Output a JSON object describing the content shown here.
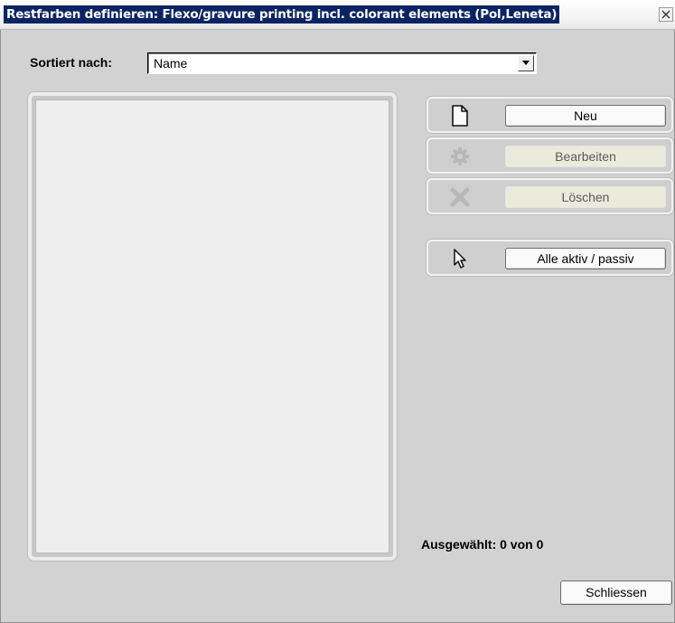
{
  "window": {
    "title": "Restfarben definieren: Flexo/gravure printing incl. colorant elements  (Pol,Leneta)",
    "close_icon": "close-icon"
  },
  "sort": {
    "label": "Sortiert nach:",
    "selected": "Name"
  },
  "list": {
    "items": []
  },
  "actions": [
    {
      "label": "Neu",
      "icon": "new-document-icon",
      "enabled": true
    },
    {
      "label": "Bearbeiten",
      "icon": "gear-icon",
      "enabled": false
    },
    {
      "label": "Löschen",
      "icon": "delete-x-icon",
      "enabled": false
    },
    {
      "label": "Alle aktiv / passiv",
      "icon": "cursor-arrow-icon",
      "enabled": true
    }
  ],
  "status": {
    "selected_text": "Ausgewählt: 0 von 0"
  },
  "footer": {
    "close_label": "Schliessen"
  }
}
